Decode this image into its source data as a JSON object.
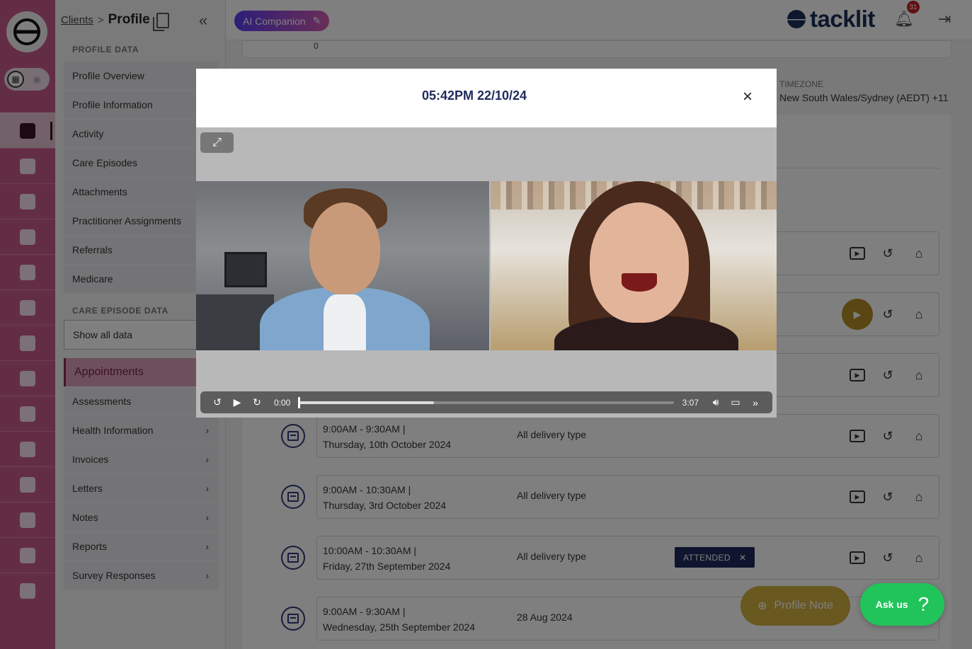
{
  "breadcrumb": {
    "parent": "Clients",
    "separator": ">",
    "current": "Profile"
  },
  "submenu": {
    "profile_data_title": "PROFILE DATA",
    "profile_items": [
      {
        "label": "Profile Overview"
      },
      {
        "label": "Profile Information"
      },
      {
        "label": "Activity"
      },
      {
        "label": "Care Episodes"
      },
      {
        "label": "Attachments"
      },
      {
        "label": "Practitioner Assignments"
      },
      {
        "label": "Referrals"
      },
      {
        "label": "Medicare"
      }
    ],
    "care_episode_title": "CARE EPISODE DATA",
    "show_all": "Show all data",
    "care_items": [
      {
        "label": "Appointments",
        "chevron": ""
      },
      {
        "label": "Assessments",
        "chevron": ""
      },
      {
        "label": "Health Information",
        "chevron": "›"
      },
      {
        "label": "Invoices",
        "chevron": "›"
      },
      {
        "label": "Letters",
        "chevron": "›"
      },
      {
        "label": "Notes",
        "chevron": "›"
      },
      {
        "label": "Reports",
        "chevron": "›"
      },
      {
        "label": "Survey Responses",
        "chevron": "›"
      }
    ]
  },
  "topbar": {
    "ai_companion": "AI Companion",
    "brand": "tacklit",
    "notification_count": "31"
  },
  "main": {
    "top_card_value": "0",
    "timezone_label": "TIMEZONE",
    "timezone_value": "New South Wales/Sydney (AEDT) +11",
    "appointments": [
      {
        "time": "9:00AM - 9:30AM |",
        "date": "Thursday, 10th October 2024",
        "type": "All delivery type",
        "status": ""
      },
      {
        "time": "9:00AM - 10:30AM |",
        "date": "Thursday, 3rd October 2024",
        "type": "All delivery type",
        "status": ""
      },
      {
        "time": "10:00AM - 10:30AM |",
        "date": "Friday, 27th September 2024",
        "type": "All delivery type",
        "status": "ATTENDED"
      },
      {
        "time": "9:00AM - 9:30AM |",
        "date": "Wednesday, 25th September 2024",
        "type": "28 Aug 2024",
        "status": ""
      }
    ],
    "profile_note": "Profile Note",
    "ask_us": "Ask us"
  },
  "modal": {
    "title": "05:42PM 22/10/24",
    "close": "×",
    "player": {
      "current_time": "0:00",
      "duration": "3:07",
      "played_fraction": 0.0,
      "buffered_fraction": 0.36
    }
  },
  "colors": {
    "rail": "#c85a8c",
    "accent": "#1f2b5c",
    "profile_note": "#d2b13f",
    "ask_us": "#21c45a"
  }
}
